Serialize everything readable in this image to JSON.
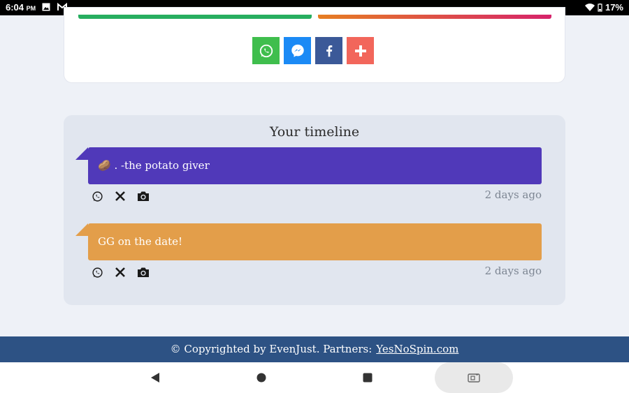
{
  "status_bar": {
    "time": "6:04",
    "ampm": "PM",
    "battery": "17%",
    "icons": [
      "image-icon",
      "gmail-icon",
      "wifi-icon",
      "battery-icon"
    ]
  },
  "share": {
    "buttons": [
      {
        "name": "whatsapp",
        "icon": "whatsapp-icon",
        "color": "#3fbe4d"
      },
      {
        "name": "messenger",
        "icon": "messenger-icon",
        "color": "#1b8af5"
      },
      {
        "name": "facebook",
        "icon": "facebook-icon",
        "color": "#3b5998"
      },
      {
        "name": "more",
        "icon": "plus-icon",
        "color": "#f2665b"
      }
    ]
  },
  "timeline": {
    "title": "Your timeline",
    "entries": [
      {
        "text": "🥔 . -the potato giver",
        "color": "#5039b9",
        "time": "2 days ago"
      },
      {
        "text": "GG on the date!",
        "color": "#e39e4a",
        "time": "2 days ago"
      }
    ]
  },
  "footer": {
    "text": "© Copyrighted by EvenJust. Partners:",
    "link": "YesNoSpin.com"
  },
  "colors": {
    "footer_bg": "#2d5284",
    "page_bg": "#eef1f7"
  }
}
